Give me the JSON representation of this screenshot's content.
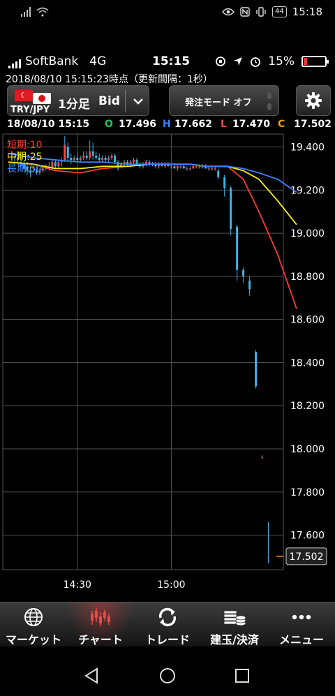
{
  "os_status": {
    "time": "15:18",
    "battery_label": "44"
  },
  "inner_status": {
    "carrier": "SoftBank",
    "network": "4G",
    "time": "15:15",
    "battery_percent": "15%",
    "battery_level": 0.15
  },
  "updated_text": "2018/08/10  15:15:23時点（更新間隔：1秒）",
  "toolbar": {
    "pair": "TRY/JPY",
    "flag_left_symbol": "☾",
    "timeframe": "1分足",
    "price_type": "Bid",
    "dropdown_symbol": "⌄",
    "order_mode": "発注モード オフ",
    "settings_icon": "gear-icon"
  },
  "ohlc": {
    "datetime": "18/08/10 15:15",
    "o_label": "O",
    "o_value": "17.496",
    "h_label": "H",
    "h_value": "17.662",
    "l_label": "L",
    "l_value": "17.470",
    "c_label": "C",
    "c_value": "17.502"
  },
  "colors": {
    "o": "#22c55e",
    "h": "#3b82f6",
    "l": "#ef4444",
    "c": "#f59e0b",
    "candle": "#3cb4e6",
    "grid": "#555555"
  },
  "chart_data": {
    "type": "candlestick",
    "ylim": [
      17.44,
      19.46
    ],
    "yticks": [
      "19.400",
      "19.200",
      "19.000",
      "18.800",
      "18.600",
      "18.400",
      "18.200",
      "18.000",
      "17.800",
      "17.600"
    ],
    "xticks": [
      "14:30",
      "15:00"
    ],
    "current_price": "17.502",
    "legend": [
      {
        "label": "短期:10",
        "color": "#ff3b30"
      },
      {
        "label": "中期:25",
        "color": "#ffee00"
      },
      {
        "label": "長期:50",
        "color": "#3b82f6"
      }
    ],
    "series": [
      {
        "name": "短期:10",
        "color": "#ff3b30",
        "values": [
          19.33,
          19.32,
          19.29,
          19.28,
          19.3,
          19.31,
          19.32,
          19.32,
          19.32,
          19.31,
          19.31,
          19.31,
          19.25,
          19.1,
          18.9,
          18.65
        ]
      },
      {
        "name": "中期:25",
        "color": "#ffee00",
        "values": [
          19.33,
          19.32,
          19.3,
          19.3,
          19.31,
          19.31,
          19.32,
          19.32,
          19.32,
          19.31,
          19.31,
          19.31,
          19.29,
          19.25,
          19.15,
          19.04
        ]
      },
      {
        "name": "長期:50",
        "color": "#3b82f6",
        "values": [
          19.37,
          19.35,
          19.34,
          19.33,
          19.33,
          19.32,
          19.32,
          19.32,
          19.32,
          19.31,
          19.31,
          19.31,
          19.3,
          19.28,
          19.25,
          19.19
        ]
      }
    ],
    "series_x": [
      0,
      8,
      15,
      23,
      30,
      38,
      45,
      52,
      58,
      63,
      66,
      70,
      75,
      80,
      86,
      92
    ],
    "x_ticks_index": [
      22,
      52
    ],
    "candles": [
      [
        2,
        19.33,
        19.36,
        19.31,
        19.33
      ],
      [
        3,
        19.34,
        19.38,
        19.32,
        19.35
      ],
      [
        4,
        19.33,
        19.36,
        19.3,
        19.31
      ],
      [
        5,
        19.32,
        19.34,
        19.28,
        19.3
      ],
      [
        6,
        19.31,
        19.33,
        19.27,
        19.29
      ],
      [
        7,
        19.29,
        19.31,
        19.26,
        19.28
      ],
      [
        8,
        19.3,
        19.32,
        19.28,
        19.31
      ],
      [
        9,
        19.29,
        19.31,
        19.27,
        19.28
      ],
      [
        10,
        19.28,
        19.3,
        19.27,
        19.29
      ],
      [
        11,
        19.29,
        19.31,
        19.28,
        19.3
      ],
      [
        12,
        19.3,
        19.32,
        19.29,
        19.31
      ],
      [
        13,
        19.31,
        19.33,
        19.29,
        19.3
      ],
      [
        14,
        19.3,
        19.34,
        19.29,
        19.33
      ],
      [
        15,
        19.33,
        19.34,
        19.3,
        19.31
      ],
      [
        16,
        19.31,
        19.34,
        19.3,
        19.33
      ],
      [
        17,
        19.33,
        19.35,
        19.31,
        19.34
      ],
      [
        18,
        19.34,
        19.45,
        19.33,
        19.41
      ],
      [
        19,
        19.4,
        19.42,
        19.33,
        19.35
      ],
      [
        20,
        19.35,
        19.37,
        19.32,
        19.34
      ],
      [
        21,
        19.34,
        19.36,
        19.33,
        19.35
      ],
      [
        22,
        19.35,
        19.37,
        19.33,
        19.34
      ],
      [
        23,
        19.34,
        19.36,
        19.33,
        19.35
      ],
      [
        24,
        19.35,
        19.38,
        19.34,
        19.36
      ],
      [
        25,
        19.36,
        19.38,
        19.34,
        19.35
      ],
      [
        26,
        19.35,
        19.43,
        19.34,
        19.38
      ],
      [
        27,
        19.38,
        19.42,
        19.34,
        19.36
      ],
      [
        28,
        19.36,
        19.38,
        19.34,
        19.35
      ],
      [
        29,
        19.35,
        19.37,
        19.33,
        19.34
      ],
      [
        30,
        19.34,
        19.36,
        19.33,
        19.35
      ],
      [
        31,
        19.35,
        19.36,
        19.33,
        19.34
      ],
      [
        32,
        19.34,
        19.36,
        19.33,
        19.35
      ],
      [
        33,
        19.35,
        19.37,
        19.34,
        19.36
      ],
      [
        34,
        19.36,
        19.37,
        19.32,
        19.33
      ],
      [
        35,
        19.33,
        19.34,
        19.29,
        19.3
      ],
      [
        36,
        19.31,
        19.33,
        19.3,
        19.32
      ],
      [
        37,
        19.32,
        19.34,
        19.31,
        19.33
      ],
      [
        38,
        19.33,
        19.34,
        19.31,
        19.32
      ],
      [
        39,
        19.32,
        19.34,
        19.31,
        19.33
      ],
      [
        40,
        19.33,
        19.35,
        19.32,
        19.34
      ],
      [
        41,
        19.34,
        19.35,
        19.31,
        19.32
      ],
      [
        42,
        19.32,
        19.33,
        19.3,
        19.31
      ],
      [
        43,
        19.31,
        19.33,
        19.3,
        19.32
      ],
      [
        44,
        19.32,
        19.34,
        19.31,
        19.33
      ],
      [
        45,
        19.33,
        19.34,
        19.31,
        19.32
      ],
      [
        46,
        19.32,
        19.33,
        19.31,
        19.32
      ],
      [
        47,
        19.32,
        19.33,
        19.3,
        19.31
      ],
      [
        48,
        19.31,
        19.33,
        19.3,
        19.32
      ],
      [
        49,
        19.32,
        19.33,
        19.31,
        19.31
      ],
      [
        50,
        19.31,
        19.33,
        19.3,
        19.32
      ],
      [
        51,
        19.32,
        19.33,
        19.31,
        19.31
      ],
      [
        52,
        19.31,
        19.32,
        19.3,
        19.31
      ],
      [
        53,
        19.31,
        19.32,
        19.3,
        19.3
      ],
      [
        54,
        19.3,
        19.32,
        19.29,
        19.31
      ],
      [
        55,
        19.31,
        19.32,
        19.3,
        19.31
      ],
      [
        56,
        19.31,
        19.32,
        19.3,
        19.3
      ],
      [
        57,
        19.3,
        19.31,
        19.29,
        19.3
      ],
      [
        58,
        19.3,
        19.31,
        19.29,
        19.3
      ],
      [
        59,
        19.3,
        19.32,
        19.3,
        19.31
      ],
      [
        60,
        19.31,
        19.32,
        19.3,
        19.31
      ],
      [
        61,
        19.31,
        19.32,
        19.3,
        19.31
      ],
      [
        62,
        19.31,
        19.32,
        19.3,
        19.31
      ],
      [
        63,
        19.31,
        19.32,
        19.3,
        19.3
      ],
      [
        64,
        19.3,
        19.31,
        19.29,
        19.3
      ],
      [
        65,
        19.3,
        19.31,
        19.29,
        19.3
      ],
      [
        66,
        19.3,
        19.31,
        19.29,
        19.3
      ],
      [
        67,
        19.29,
        19.3,
        19.25,
        19.26
      ],
      [
        69,
        19.26,
        19.27,
        19.17,
        19.21
      ],
      [
        71,
        19.21,
        19.22,
        18.99,
        19.02
      ],
      [
        73,
        19.03,
        19.04,
        18.78,
        18.83
      ],
      [
        75,
        18.83,
        18.84,
        18.77,
        18.8
      ],
      [
        77,
        18.78,
        18.8,
        18.71,
        18.74
      ],
      [
        79,
        18.45,
        18.46,
        18.28,
        18.29
      ],
      [
        81,
        17.96,
        17.97,
        17.96,
        17.96
      ],
      [
        83,
        17.5,
        17.66,
        17.47,
        17.5
      ]
    ]
  },
  "bottom_nav": [
    {
      "label": "マーケット",
      "icon": "globe-icon"
    },
    {
      "label": "チャート",
      "icon": "chart-icon"
    },
    {
      "label": "トレード",
      "icon": "trade-icon"
    },
    {
      "label": "建玉/決済",
      "icon": "coins-icon"
    },
    {
      "label": "メニュー",
      "icon": "menu-dots-icon"
    }
  ]
}
